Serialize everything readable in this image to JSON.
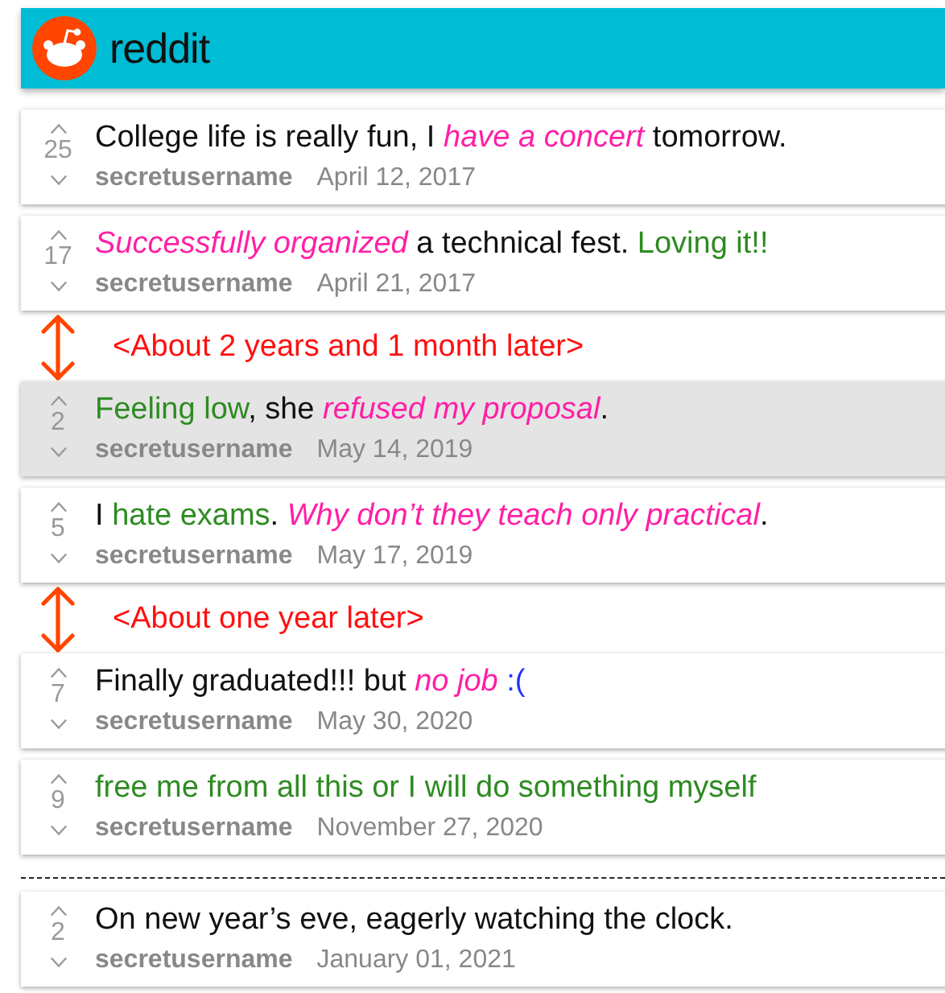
{
  "header": {
    "title": "reddit"
  },
  "feed": [
    {
      "kind": "post",
      "highlighted": false,
      "score": "25",
      "author": "secretusername",
      "date": "April 12, 2017",
      "segments": [
        {
          "text": "College life is really fun, I ",
          "color": "#111111",
          "italic": false
        },
        {
          "text": "have a concert",
          "color": "#ff1fa5",
          "italic": true
        },
        {
          "text": " tomorrow.",
          "color": "#111111",
          "italic": false
        }
      ]
    },
    {
      "kind": "post",
      "highlighted": false,
      "score": "17",
      "author": "secretusername",
      "date": "April 21, 2017",
      "segments": [
        {
          "text": "Successfully organized",
          "color": "#ff1fa5",
          "italic": true
        },
        {
          "text": " a technical fest. ",
          "color": "#111111",
          "italic": false
        },
        {
          "text": "Loving it!!",
          "color": "#2e8b22",
          "italic": false
        }
      ]
    },
    {
      "kind": "gap",
      "label": "<About 2 years and 1 month later>"
    },
    {
      "kind": "post",
      "highlighted": true,
      "score": "2",
      "author": "secretusername",
      "date": "May 14, 2019",
      "segments": [
        {
          "text": "Feeling low",
          "color": "#2e8b22",
          "italic": false
        },
        {
          "text": ", she ",
          "color": "#111111",
          "italic": false
        },
        {
          "text": "refused my proposal",
          "color": "#ff1fa5",
          "italic": true
        },
        {
          "text": ".",
          "color": "#111111",
          "italic": false
        }
      ]
    },
    {
      "kind": "post",
      "highlighted": false,
      "score": "5",
      "author": "secretusername",
      "date": "May 17, 2019",
      "segments": [
        {
          "text": "I ",
          "color": "#111111",
          "italic": false
        },
        {
          "text": "hate exams",
          "color": "#2e8b22",
          "italic": false
        },
        {
          "text": ". ",
          "color": "#111111",
          "italic": false
        },
        {
          "text": "Why don’t they teach only practical",
          "color": "#ff1fa5",
          "italic": true
        },
        {
          "text": ".",
          "color": "#111111",
          "italic": false
        }
      ]
    },
    {
      "kind": "gap",
      "label": "<About one year later>"
    },
    {
      "kind": "post",
      "highlighted": false,
      "score": "7",
      "author": "secretusername",
      "date": "May 30, 2020",
      "segments": [
        {
          "text": "Finally graduated!!! but ",
          "color": "#111111",
          "italic": false
        },
        {
          "text": "no job",
          "color": "#ff1fa5",
          "italic": true
        },
        {
          "text": " :(",
          "color": "#2233ff",
          "italic": false
        }
      ]
    },
    {
      "kind": "post",
      "highlighted": false,
      "score": "9",
      "author": "secretusername",
      "date": "November 27, 2020",
      "segments": [
        {
          "text": "free me from all this or I will do something myself",
          "color": "#2e8b22",
          "italic": false
        }
      ]
    },
    {
      "kind": "divider"
    },
    {
      "kind": "post",
      "highlighted": false,
      "score": "2",
      "author": "secretusername",
      "date": "January 01, 2021",
      "segments": [
        {
          "text": "On new year’s eve, eagerly watching the clock.",
          "color": "#111111",
          "italic": false
        }
      ]
    }
  ]
}
